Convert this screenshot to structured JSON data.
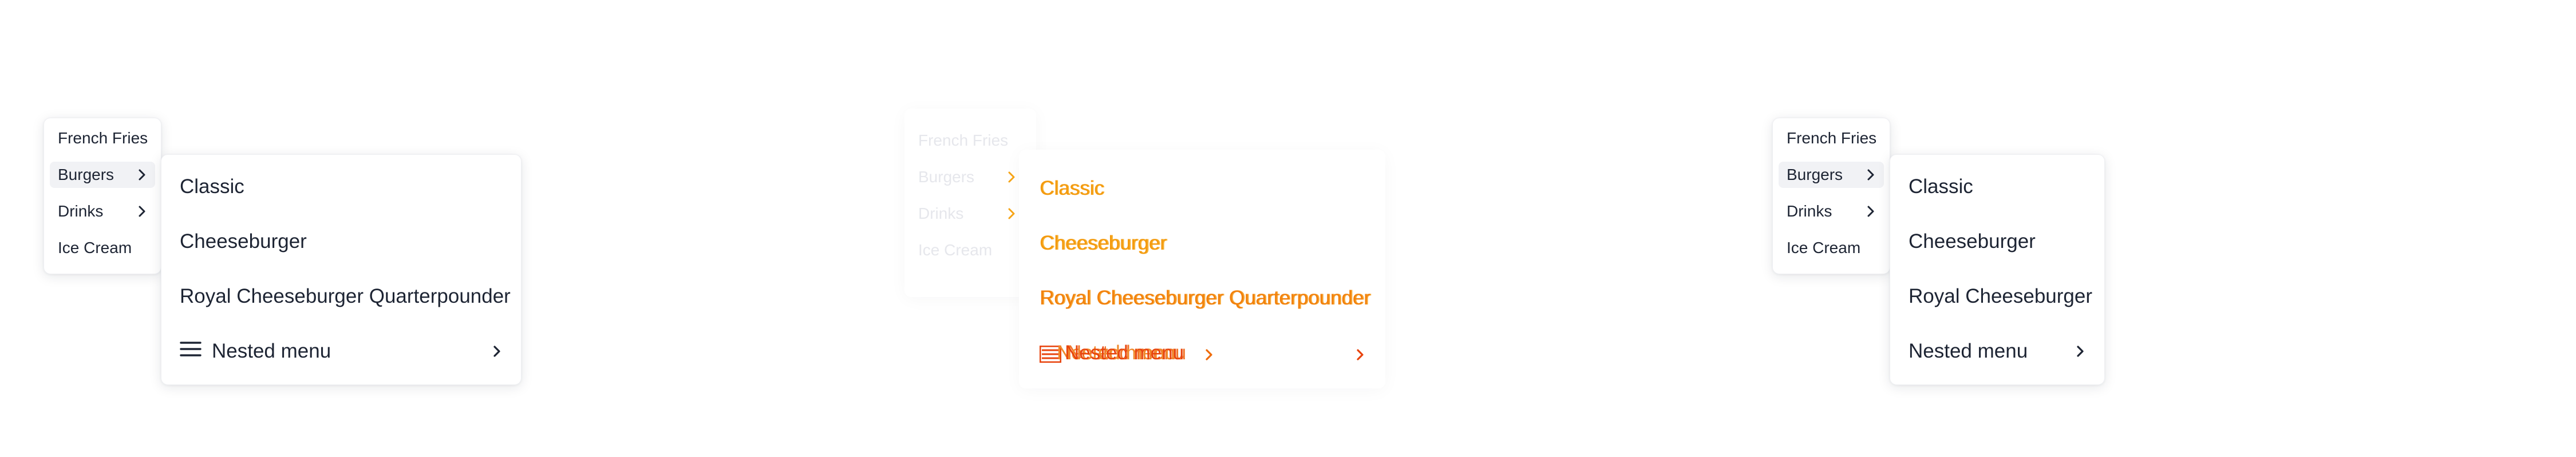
{
  "left_panel": {
    "root_menu": [
      {
        "label": "French Fries",
        "has_submenu": false,
        "active": false
      },
      {
        "label": "Burgers",
        "has_submenu": true,
        "active": true
      },
      {
        "label": "Drinks",
        "has_submenu": true,
        "active": false
      },
      {
        "label": "Ice Cream",
        "has_submenu": false,
        "active": false
      }
    ],
    "submenu": [
      {
        "label": "Classic"
      },
      {
        "label": "Cheeseburger"
      },
      {
        "label": "Royal Cheeseburger Quarterpounder"
      },
      {
        "label": "Nested menu",
        "icon": "hamburger-menu-icon",
        "has_submenu": true
      }
    ]
  },
  "middle_panel": {
    "root_menu": [
      {
        "label": "French Fries"
      },
      {
        "label": "Burgers"
      },
      {
        "label": "Drinks"
      },
      {
        "label": "Ice Cream"
      }
    ],
    "submenu": [
      {
        "label": "Classic"
      },
      {
        "label": "Cheeseburger"
      },
      {
        "label": "Royal Cheeseburger Quarterpounder"
      },
      {
        "label": "Nested menu"
      }
    ],
    "colors": {
      "ghost": "#e6e7ec",
      "orange": "#f6a416",
      "red": "#e8430d"
    }
  },
  "right_panel": {
    "root_menu": [
      {
        "label": "French Fries",
        "has_submenu": false,
        "active": false
      },
      {
        "label": "Burgers",
        "has_submenu": true,
        "active": true
      },
      {
        "label": "Drinks",
        "has_submenu": true,
        "active": false
      },
      {
        "label": "Ice Cream",
        "has_submenu": false,
        "active": false
      }
    ],
    "submenu": [
      {
        "label": "Classic"
      },
      {
        "label": "Cheeseburger"
      },
      {
        "label": "Royal Cheeseburger"
      },
      {
        "label": "Nested menu",
        "has_submenu": true
      }
    ]
  }
}
